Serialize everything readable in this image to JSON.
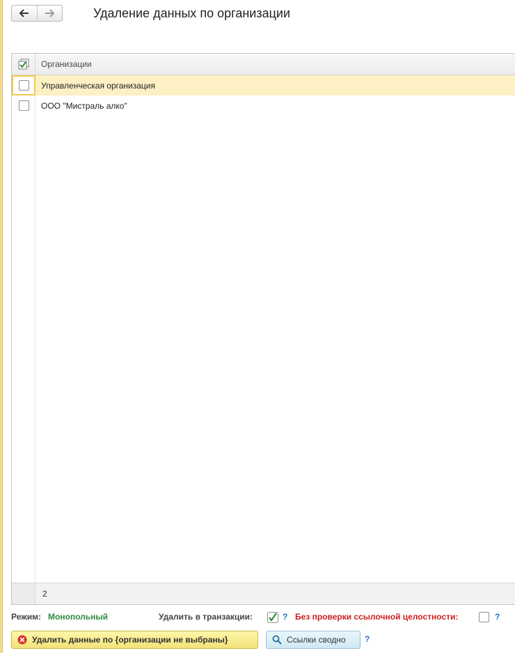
{
  "header": {
    "title": "Удаление данных по организации",
    "back_label": "←",
    "forward_label": "→"
  },
  "table": {
    "column_header": "Организации",
    "rows": [
      {
        "name": "Управленческая организация",
        "checked": false,
        "selected": true
      },
      {
        "name": "ООО \"Мистраль алко\"",
        "checked": false,
        "selected": false
      }
    ],
    "footer_count": "2"
  },
  "options": {
    "mode_label": "Режим:",
    "mode_value": "Монопольный",
    "transaction_label": "Удалить в транзакции:",
    "transaction_checked": true,
    "transaction_help": "?",
    "no_integrity_label": "Без проверки ссылочной целостности:",
    "no_integrity_checked": false,
    "no_integrity_help": "?"
  },
  "actions": {
    "delete_button_label": "Удалить данные по {организации не выбраны}",
    "links_button_label": "Ссылки сводно",
    "links_help": "?"
  },
  "colors": {
    "mode_value": "#2e8b3e",
    "warning_label": "#cc1f1f",
    "help_link": "#1f6fcf",
    "selected_row": "#fdf0c5",
    "delete_button": "#f3e27a",
    "links_button": "#cfe9f4"
  },
  "icons": {
    "back": "arrow-left-icon",
    "forward": "arrow-right-icon",
    "header_check": "check-all-icon",
    "delete": "error-circle-icon",
    "search": "magnifier-icon"
  }
}
